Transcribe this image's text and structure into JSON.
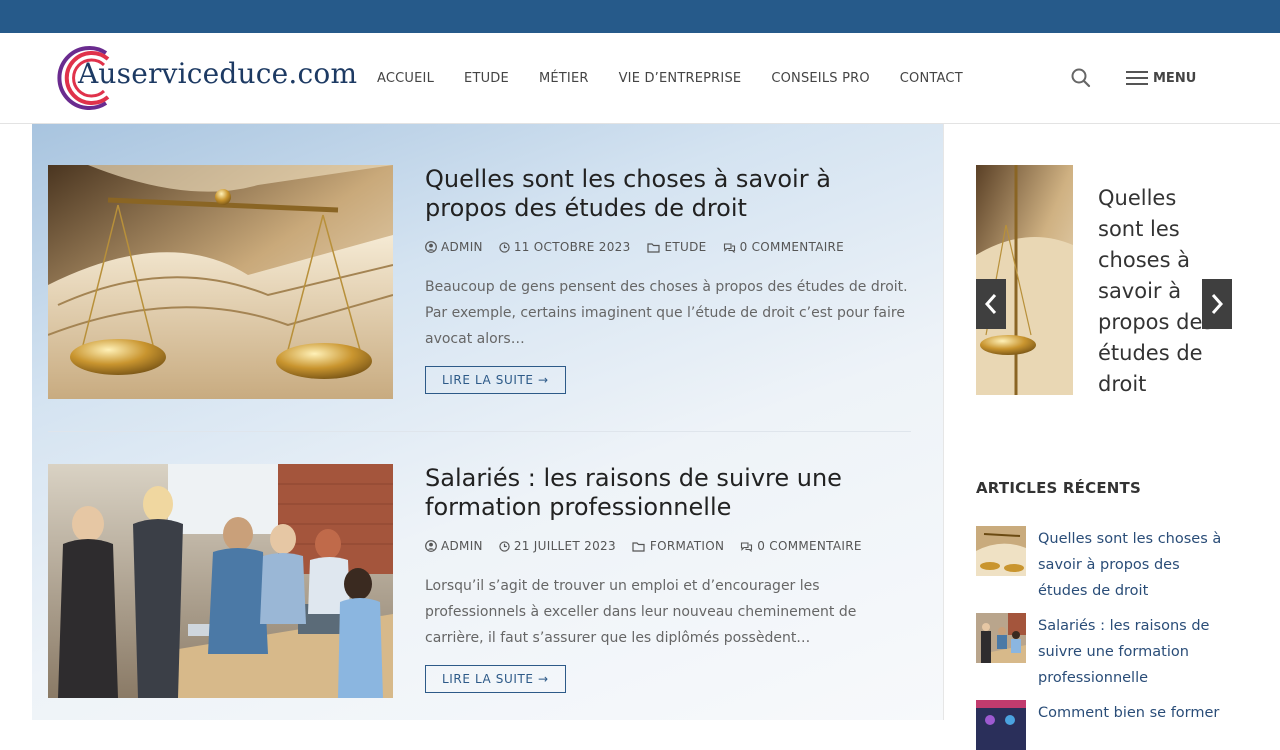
{
  "site": {
    "logo_text": "Auserviceduce.com"
  },
  "nav": {
    "items": [
      {
        "label": "ACCUEIL"
      },
      {
        "label": "ETUDE"
      },
      {
        "label": "MÉTIER"
      },
      {
        "label": "VIE D’ENTREPRISE"
      },
      {
        "label": "CONSEILS PRO"
      },
      {
        "label": "CONTACT"
      }
    ],
    "menu_label": "MENU"
  },
  "posts": [
    {
      "title": "Quelles sont les choses à savoir à propos des études de droit",
      "author": "ADMIN",
      "date": "11 OCTOBRE 2023",
      "category": "ETUDE",
      "comments": "0 COMMENTAIRE",
      "excerpt": "Beaucoup de gens pensent des choses à propos des études de droit. Par exemple, certains imaginent que l’étude de droit c’est pour faire avocat alors…",
      "read_more": "LIRE LA SUITE →"
    },
    {
      "title": "Salariés : les raisons de suivre une formation professionnelle",
      "author": "ADMIN",
      "date": "21 JUILLET 2023",
      "category": "FORMATION",
      "comments": "0 COMMENTAIRE",
      "excerpt": "Lorsqu’il s’agit de trouver un emploi et d’encourager les professionnels à exceller dans leur nouveau cheminement de carrière, il faut s’assurer que les diplômés possèdent…",
      "read_more": "LIRE LA SUITE →"
    }
  ],
  "sidebar": {
    "slider": {
      "title": "Quelles sont les choses à savoir à propos des études de droit"
    },
    "recent_title": "ARTICLES RÉCENTS",
    "recent": [
      {
        "title": "Quelles sont les choses à savoir à propos des études de droit"
      },
      {
        "title": "Salariés : les raisons de suivre une formation professionnelle"
      },
      {
        "title": "Comment bien se former"
      }
    ]
  },
  "colors": {
    "topbar": "#265a8a",
    "link": "#2a4d78",
    "logo_ring_red": "#e0324b",
    "logo_ring_purple": "#6a2b8f"
  }
}
